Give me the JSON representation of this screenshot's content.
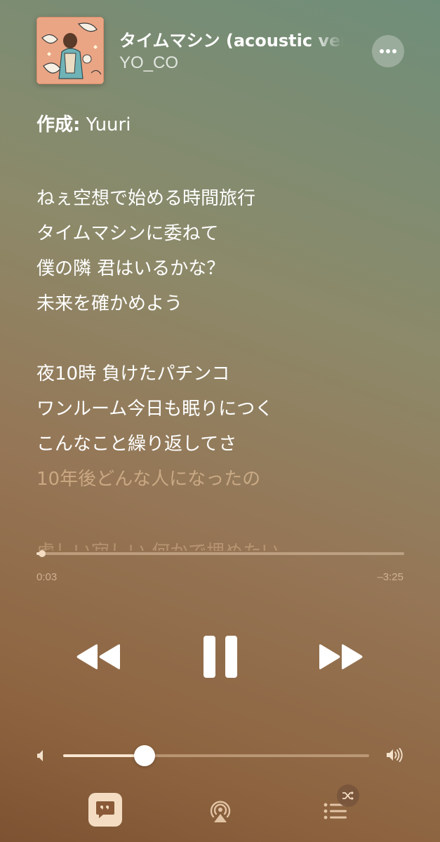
{
  "now_playing": {
    "title": "タイムマシン (acoustic ver",
    "artist": "YO_CO",
    "artwork_icon": "album-artwork"
  },
  "lyrics": {
    "writer_label": "作成:",
    "writer_name": "Yuuri",
    "stanza1": [
      "ねぇ空想で始める時間旅行",
      "タイムマシンに委ねて",
      "僕の隣 君はいるかな？",
      "未来を確かめよう"
    ],
    "stanza2": [
      "夜10時 負けたパチンコ",
      "ワンルーム今日も眠りにつく",
      "こんなこと繰り返してさ",
      "10年後どんな人になったの"
    ],
    "next_line": "虚しい寂しい 何かで埋めたい"
  },
  "playback": {
    "elapsed": "0:03",
    "remaining": "–3:25",
    "progress_fraction": 0.014,
    "state": "playing"
  },
  "volume": {
    "level_fraction": 0.267
  },
  "icons": {
    "more": "more-icon",
    "rewind": "rewind-icon",
    "pause": "pause-icon",
    "forward": "fast-forward-icon",
    "volume_low": "volume-low-icon",
    "volume_high": "volume-high-icon",
    "lyrics": "lyrics-icon",
    "airplay": "airplay-icon",
    "queue": "queue-icon",
    "shuffle": "shuffle-icon"
  },
  "colors": {
    "accent": "#f3dcc2",
    "text": "#ffffff"
  }
}
